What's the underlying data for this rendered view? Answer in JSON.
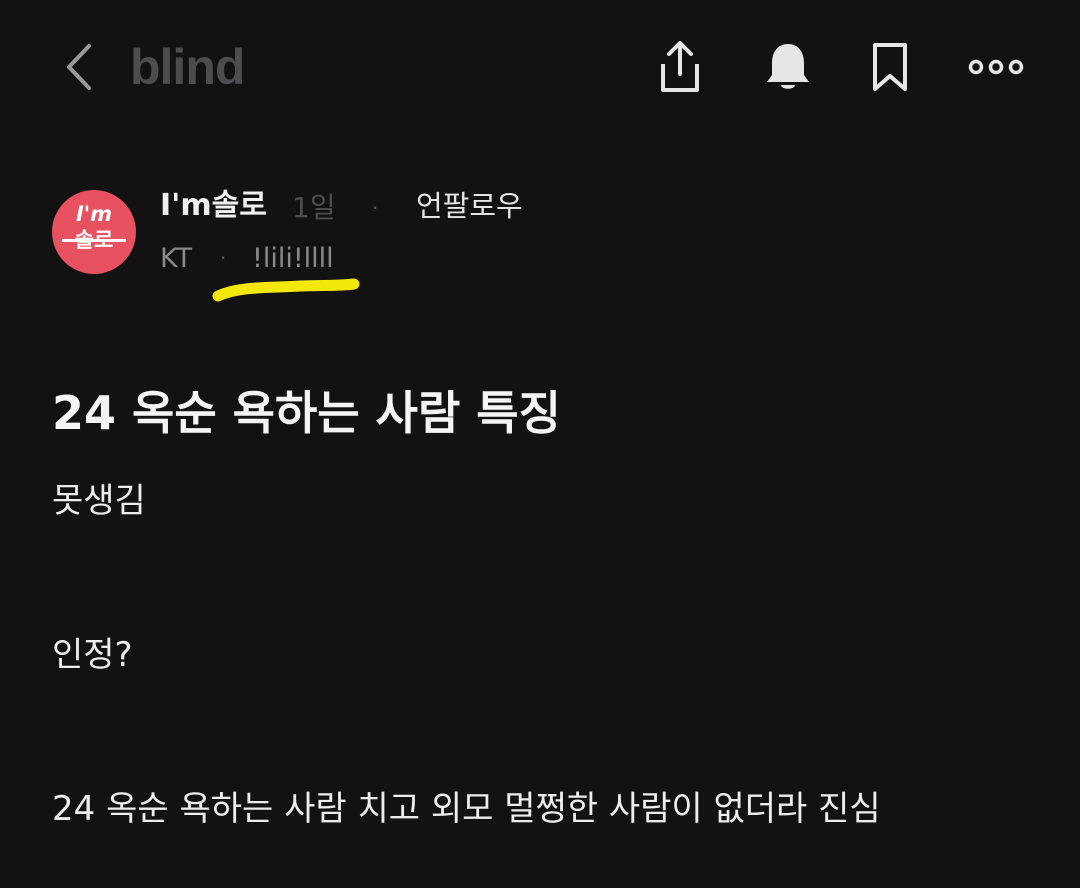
{
  "header": {
    "brand": "blind",
    "icons": {
      "back": "chevron-left-icon",
      "share": "share-icon",
      "notify": "bell-icon",
      "bookmark": "bookmark-icon",
      "more": "more-icon"
    }
  },
  "author": {
    "avatar_line1": "I'm",
    "avatar_line2": "솔로",
    "name": "I'm솔로",
    "time": "1일",
    "separator": "·",
    "follow_label": "언팔로우",
    "company": "KT",
    "nickname": "!lili!llll"
  },
  "post": {
    "title": "24 옥순 욕하는 사람 특징",
    "paragraphs": [
      "못생김",
      "인정?",
      "24 옥순 욕하는 사람 치고 외모 멀쩡한 사람이 없더라 진심"
    ]
  },
  "colors": {
    "background": "#121213",
    "brand": "#4d4d4f",
    "avatar": "#e8515f",
    "highlight": "#f4e80a",
    "muted": "#8a8a8c"
  }
}
